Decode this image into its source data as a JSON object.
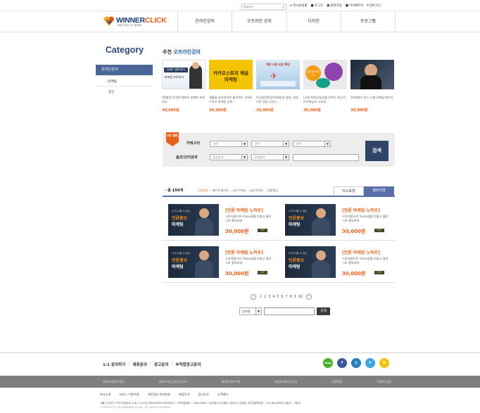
{
  "topbar": {
    "search_placeholder": "Search",
    "links": [
      "위시쇼핑몰",
      "로그인",
      "회원가입",
      "마이페이지",
      "장바구니"
    ]
  },
  "logo": {
    "text_main": "WINNER",
    "text_accent": "CLICK",
    "sub": "종합마케팅 광고플랫폼"
  },
  "gnb": [
    "온라인강의",
    "오프라인 강의",
    "디자인",
    "프로그램"
  ],
  "sidebar": {
    "title": "Category",
    "active": "온라인강의",
    "sub_items": [
      "· 마케팅",
      "일반"
    ]
  },
  "recommend": {
    "title_prefix": "추천",
    "title_highlight": "오프라인강의",
    "products": [
      {
        "thumb_text": "트렌드 캠퍼 리더",
        "thumb_sub": "마케팅 프로되기",
        "name": "[왕벌인] 트렌드캠퍼의 마케팅 프로되기",
        "price": "30,000원"
      },
      {
        "thumb_text": "카카오스토리 채널 마케팅",
        "thumb_sub": "",
        "name": "재롱을 비유적으로 풀어주는 카카오 스토리 마케팅 강의...",
        "price": "30,000원"
      },
      {
        "thumb_text": "해외 오픈 유입 특강",
        "thumb_sub": "",
        "name": "[1인창업특강]미래온라 창업, 따라디든 영상 나오는...",
        "price": "30,000원"
      },
      {
        "thumb_text": "성공한 스토리",
        "thumb_sub": "",
        "name": "[스토커특강]성공을 부르는 특소기 트러마냥코 스타치...",
        "price": "30,000원"
      },
      {
        "thumb_text": "",
        "thumb_sub": "",
        "name": "10억짜리 웃수 소셜 마케팅 배우기",
        "price": "30,000원"
      }
    ]
  },
  "search_panel": {
    "badge": "위너 클릭",
    "category_label": "카테고리",
    "option_label": "옵션/단어검색",
    "select_placeholder": "선택",
    "option_select": "옵션검색",
    "all_select": "전체검색",
    "button": "검색"
  },
  "list": {
    "total_prefix": "총",
    "total_count": "150개",
    "sort_options": [
      "신상품순",
      "베스트셀러순",
      "낮은가격순",
      "높은가격순",
      "상품평순"
    ],
    "tab_list": "리스트형",
    "tab_gallery": "갤러리형"
  },
  "cards": [
    {
      "thumb_top": "누구나 할 수 있는",
      "thumb_hl": "언론홍보",
      "thumb_bottom": "마케팅",
      "title": "[언론 마케팅 노하우]",
      "desc": "스토어팜으로 우요쇼핑몰 만들고 블로그로 홍보하자",
      "price": "30,000원",
      "badge": "HIT"
    },
    {
      "thumb_top": "누구나 할 수 있는",
      "thumb_hl": "언론홍보",
      "thumb_bottom": "마케팅",
      "title": "[언론 마케팅 노하우]",
      "desc": "스토어팜으로 우요쇼핑몰 만들고 블로그로 홍보하자",
      "price": "30,000원",
      "badge": "HIT"
    },
    {
      "thumb_top": "누구나 할 수 있는",
      "thumb_hl": "언론홍보",
      "thumb_bottom": "마케팅",
      "title": "[언론 마케팅 노하우]",
      "desc": "스토어팜으로 우요쇼핑몰 만들고 블로그로 홍보하자",
      "price": "30,000원",
      "badge": "HIT"
    },
    {
      "thumb_top": "누구나 할 수 있는",
      "thumb_hl": "언론홍보",
      "thumb_bottom": "마케팅",
      "title": "[언론 마케팅 노하우]",
      "desc": "스토어팜으로 우요쇼핑몰 만들고 블로그로 홍보하자",
      "price": "30,000원",
      "badge": "HIT"
    }
  ],
  "pager": {
    "prev": "‹",
    "next": "›",
    "pages": [
      "1",
      "2",
      "3",
      "4",
      "5",
      "6",
      "7",
      "8",
      "9",
      "10"
    ]
  },
  "bottom_search": {
    "select": "강의명",
    "button": "검색"
  },
  "footer": {
    "links": [
      "1:1 문의하기",
      "제휴문의",
      "광고문의",
      "부적합광고문의"
    ],
    "sns": [
      {
        "label": "blog",
        "color": "#4caf2a"
      },
      {
        "label": "f",
        "color": "#3b5998"
      },
      {
        "label": "◎",
        "color": "#2b7fbf"
      },
      {
        "label": "t",
        "color": "#3aa7e0"
      },
      {
        "label": "k",
        "color": "#f4c20d"
      }
    ],
    "gray_items": [
      "채효마케팅어센트",
      "채효마케팅 완라인강의",
      "매일마케터우편",
      "매일마케터와 광장",
      "위원위원",
      "위원위 광장"
    ],
    "menu": [
      "회사소개",
      "서비스 이용약관",
      "개인정보 처리방침",
      "제휴문의",
      "광고문의",
      "고객센터"
    ],
    "address": "서울시 금천구 가산디지털1로 128, 1511호 (에이스테크노타워18차) / 고객지원센터 : 1544-8483 / 상호명:(주)인앤트 대표이사:김정훈 사업자등록번호 : 119-86-82465 대표자 : 이한우",
    "copyright": "COPYRIGHT © 2016 WINNERCLICK INC. ALL RIGHTS RESERVED"
  }
}
